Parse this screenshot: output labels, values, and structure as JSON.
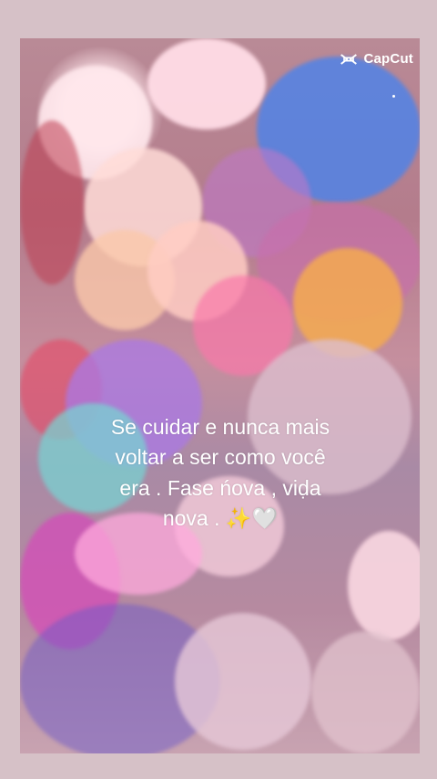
{
  "logo": {
    "text": "CapCut",
    "icon": "capcut-logo-icon"
  },
  "caption": {
    "line1": "Se cuidar e nunca mais",
    "line2": "voltar a ser como você",
    "line3": "era . Fase ńova , viḍa",
    "line4": "nova . ✨🤍"
  },
  "colors": {
    "frame": "#d6c1c7",
    "text": "#ffffff"
  }
}
